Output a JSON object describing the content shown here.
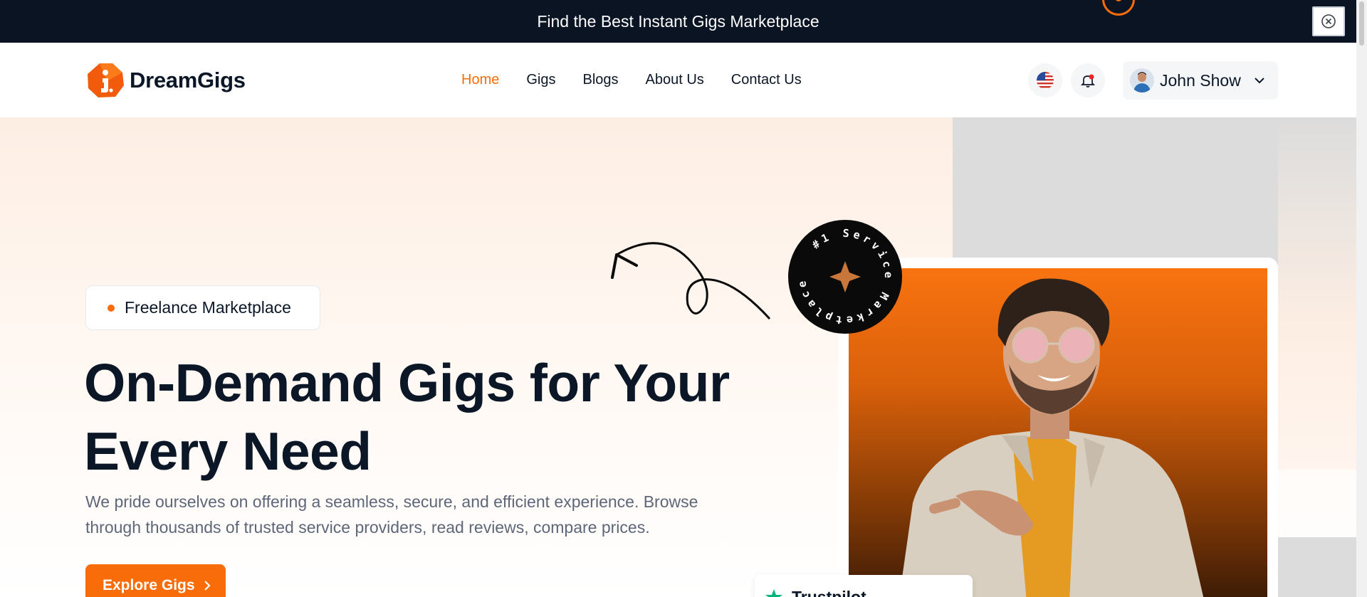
{
  "announcement": {
    "text": "Find the Best Instant Gigs Marketplace",
    "close_icon": "close-circle-icon"
  },
  "brand": {
    "name": "DreamGigs",
    "accent_color": "#f96c0a",
    "dark_color": "#0b1727"
  },
  "nav": {
    "items": [
      {
        "label": "Home",
        "active": true
      },
      {
        "label": "Gigs",
        "active": false
      },
      {
        "label": "Blogs",
        "active": false
      },
      {
        "label": "About Us",
        "active": false
      },
      {
        "label": "Contact Us",
        "active": false
      }
    ]
  },
  "header": {
    "language_icon": "us-flag-icon",
    "notification_icon": "bell-icon",
    "user": {
      "name": "John Show",
      "menu_icon": "chevron-down-icon"
    }
  },
  "hero": {
    "pill_label": "Freelance Marketplace",
    "headline_line1": "On-Demand Gigs for Your",
    "headline_line2": "Every Need",
    "subtext_line1": "We pride ourselves on offering a seamless, secure, and efficient experience. Browse",
    "subtext_line2": "through thousands of trusted service providers, read reviews, compare prices.",
    "cta_label": "Explore Gigs",
    "badge_text": "#1 Service Marketplace",
    "trust_label": "Trustpilot"
  }
}
